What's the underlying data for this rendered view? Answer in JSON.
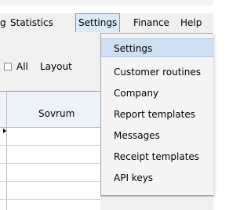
{
  "menubar": {
    "items": [
      {
        "label": "g"
      },
      {
        "label": "Statistics"
      },
      {
        "label": "Settings"
      },
      {
        "label": "Finance"
      },
      {
        "label": "Help"
      }
    ]
  },
  "toolbar": {
    "all_label": "All",
    "layout_label": "Layout"
  },
  "grid": {
    "column_header": "Sovrum"
  },
  "settings_menu": {
    "items": [
      {
        "label": "Settings"
      },
      {
        "label": "Customer routines"
      },
      {
        "label": "Company"
      },
      {
        "label": "Report templates"
      },
      {
        "label": "Messages"
      },
      {
        "label": "Receipt templates"
      },
      {
        "label": "API keys"
      }
    ]
  }
}
